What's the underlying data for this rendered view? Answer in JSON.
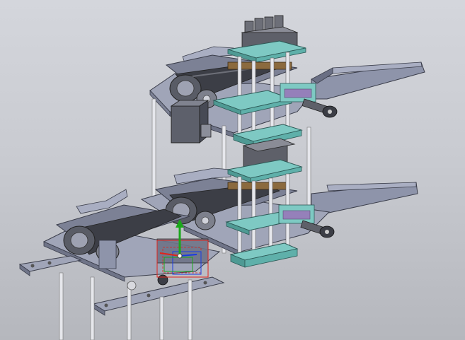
{
  "viewport": {
    "background_top": "#d4d6dc",
    "background_bottom": "#b5b7bd"
  },
  "model": {
    "colors": {
      "frame": "#8e94aa",
      "frame_light": "#a9aec2",
      "frame_dark": "#5e6378",
      "teal_plate": "#7ec9c3",
      "teal_dark": "#4f9a94",
      "belt": "#3c3e46",
      "roller": "#9ea2b2",
      "post": "#e6e7ec",
      "block": "#6d6f78",
      "wood": "#8b6a3e"
    }
  },
  "triad": {
    "icon": "coordinate-triad-icon",
    "axis_colors": {
      "x": "#e2231a",
      "y": "#1aa81a",
      "z": "#1a3be2"
    }
  }
}
